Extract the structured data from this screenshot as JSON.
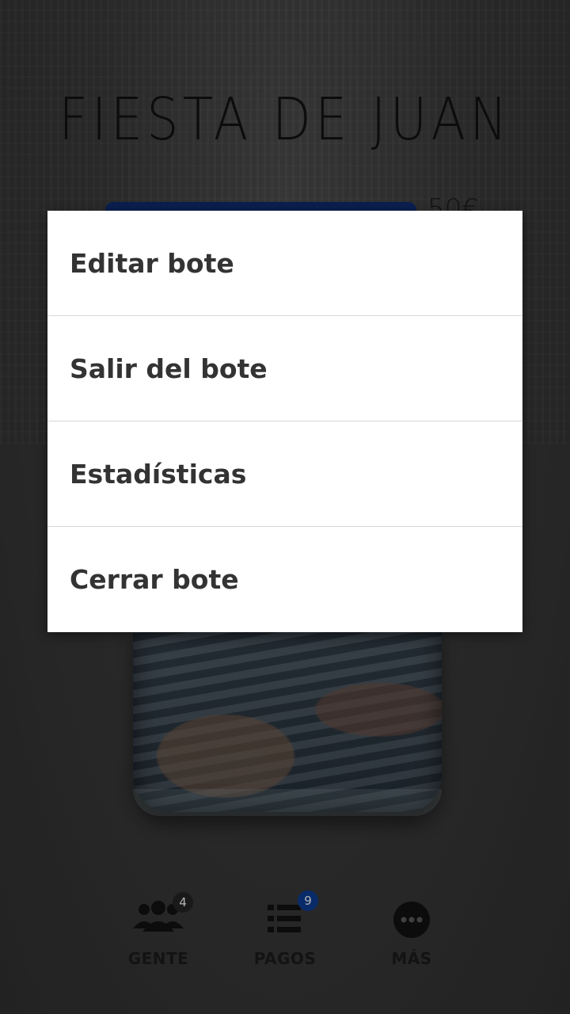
{
  "screen": {
    "title": "FIESTA DE JUAN",
    "amount_partial": "50€",
    "progress_color": "#0e2a6b"
  },
  "menu": {
    "items": [
      {
        "label": "Editar bote"
      },
      {
        "label": "Salir del bote"
      },
      {
        "label": "Estadísticas"
      },
      {
        "label": "Cerrar bote"
      }
    ]
  },
  "bottom_nav": {
    "gente": {
      "label": "GENTE",
      "badge": "4",
      "icon": "people-icon",
      "badge_color": "#222222"
    },
    "pagos": {
      "label": "PAGOS",
      "badge": "9",
      "icon": "list-icon",
      "badge_color": "#0d3a8c"
    },
    "mas": {
      "label": "MÁS",
      "icon": "more-icon"
    }
  }
}
